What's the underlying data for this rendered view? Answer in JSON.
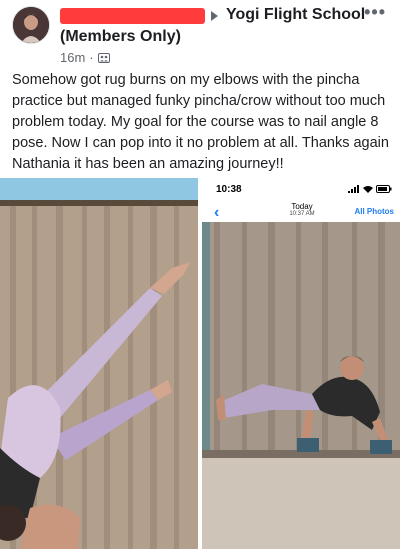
{
  "post": {
    "group_name": "Yogi Flight School",
    "group_subtitle": "(Members Only)",
    "time_ago": "16m",
    "separator": "·",
    "privacy_icon": "group-icon",
    "more_icon": "more-dots-icon",
    "more_glyph": "•••",
    "body": "Somehow got rug burns on my elbows with the pincha practice but managed funky pincha/crow without too much problem today. My goal for the course was to nail angle 8 pose. Now I can pop into it no problem at all. Thanks again Nathania it has been an amazing journey!!"
  },
  "phone_screenshot": {
    "status_time": "10:38",
    "nav_title": "Today",
    "nav_subtitle": "10:37 AM",
    "right_action": "All Photos",
    "back_glyph": "‹",
    "back_icon": "chevron-left-icon"
  },
  "colors": {
    "redaction": "#ff3b3b",
    "ios_blue": "#1e7bf0",
    "text": "#1c1e21",
    "meta": "#606770"
  }
}
